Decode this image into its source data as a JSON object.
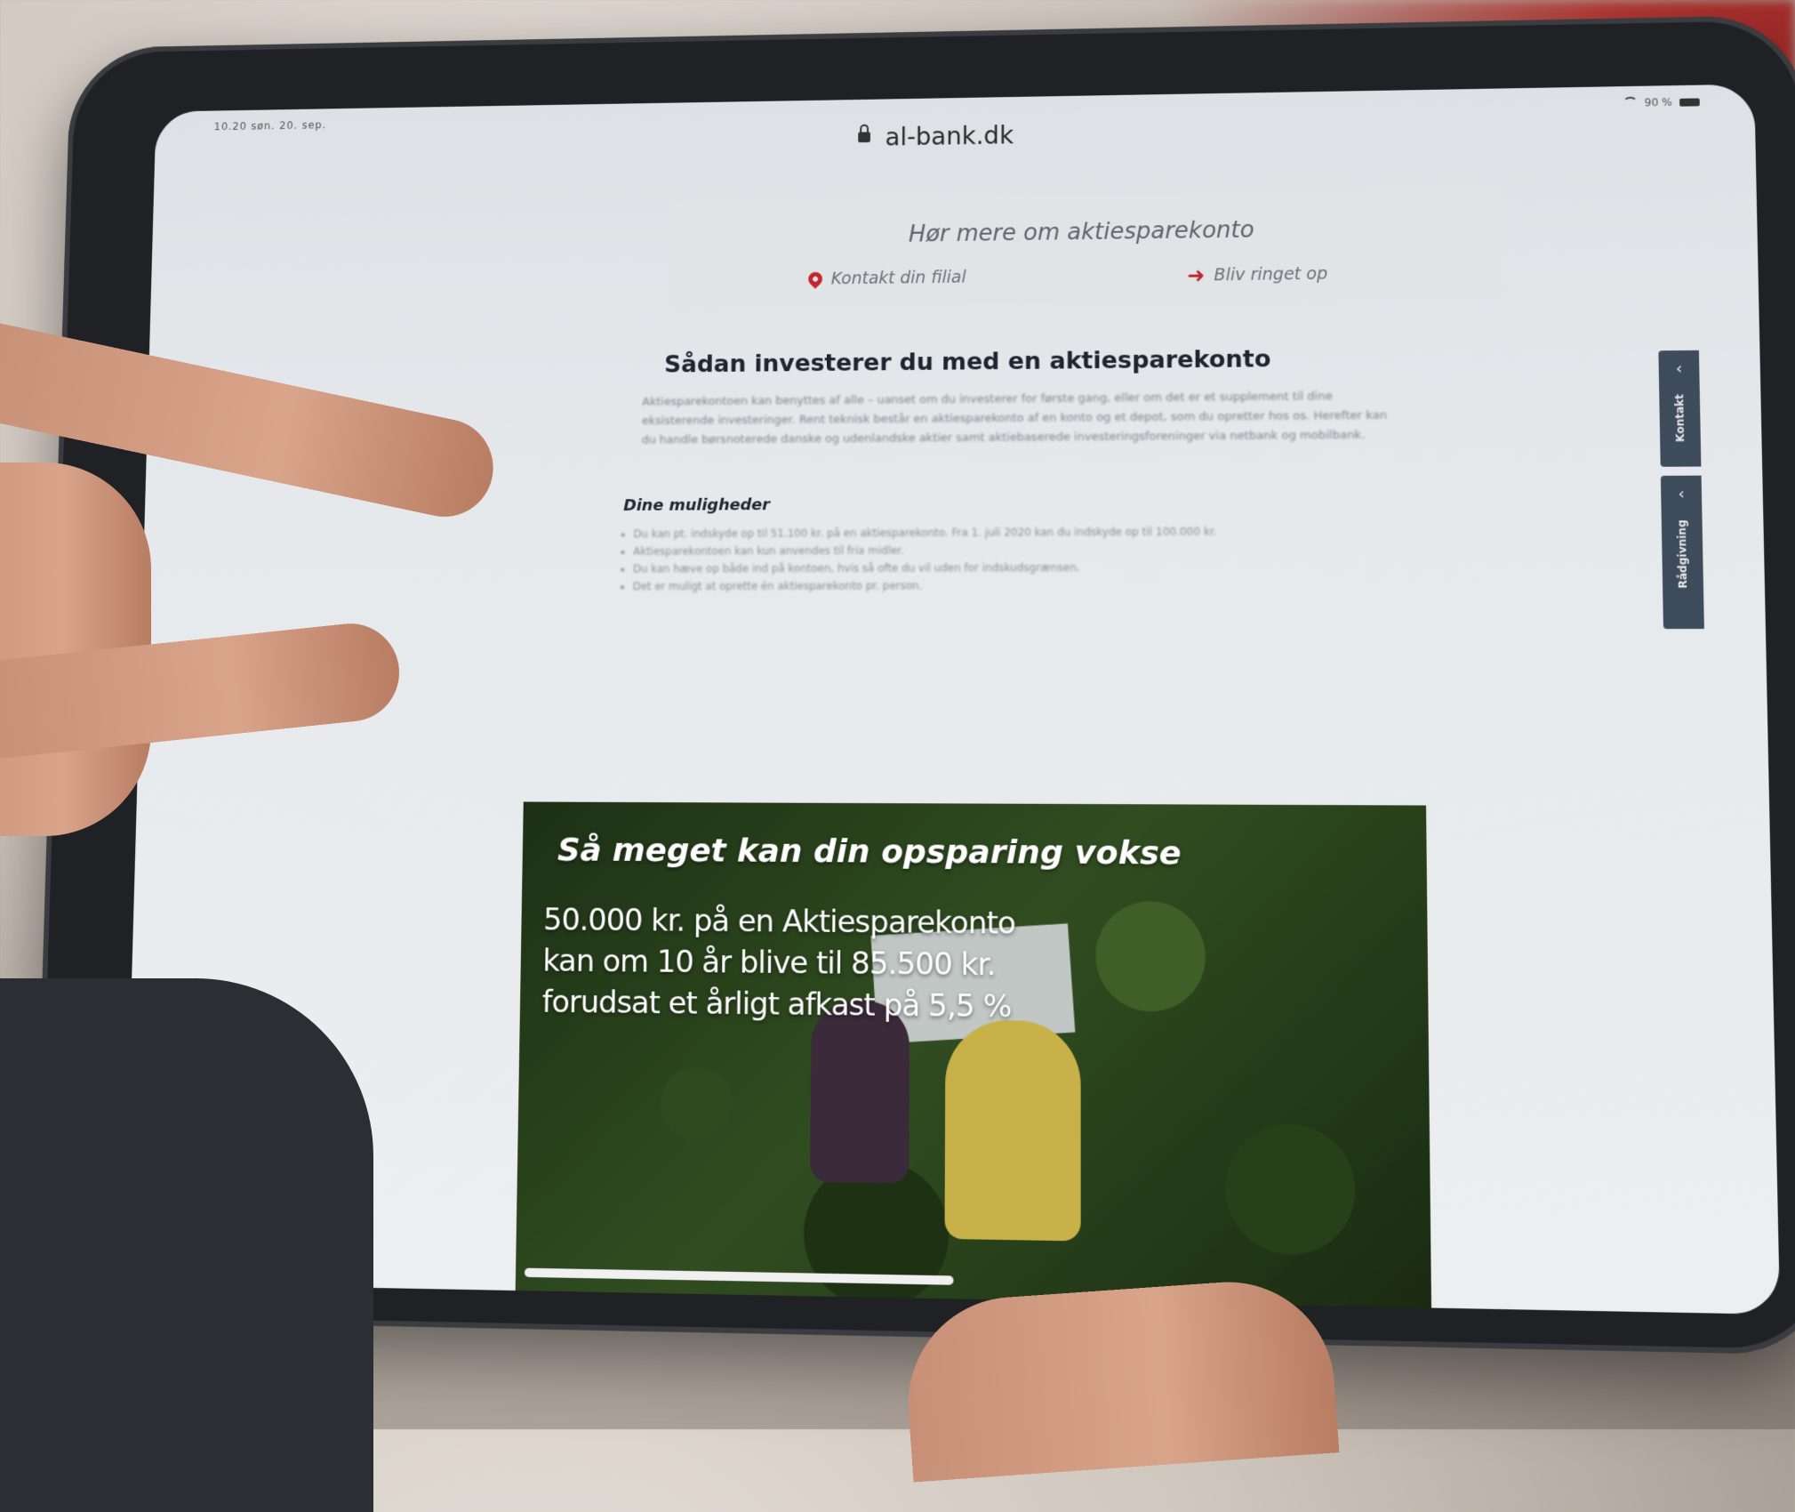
{
  "browser": {
    "url": "al-bank.dk",
    "status_time": "10.20 søn. 20. sep.",
    "status_battery": "90 %"
  },
  "contact": {
    "title": "Hør mere om aktiesparekonto",
    "branch_label": "Kontakt din filial",
    "call_label": "Bliv ringet op"
  },
  "article": {
    "title": "Sådan investerer du med en aktiesparekonto",
    "paragraph": "Aktiesparekontoen kan benyttes af alle – uanset om du investerer for første gang, eller om det er et supplement til dine eksisterende investeringer. Rent teknisk består en aktiesparekonto af en konto og et depot, som du opretter hos os. Herefter kan du handle børsnoterede danske og udenlandske aktier samt aktiebaserede investeringsforeninger via netbank og mobilbank.",
    "subheading": "Dine muligheder",
    "bullets": [
      "Du kan pt. indskyde op til 51.100 kr. på en aktiesparekonto. Fra 1. juli 2020 kan du indskyde op til 100.000 kr.",
      "Aktiesparekontoen kan kun anvendes til fria midler.",
      "Du kan hæve op både ind på kontoen, hvis så ofte du vil uden for indskudsgrænsen.",
      "Det er muligt at oprette én aktiesparekonto pr. person."
    ]
  },
  "side_tabs": {
    "tab1_label": "Kontakt",
    "tab2_label": "Rådgivning"
  },
  "banner": {
    "title": "Så meget kan din opsparing vokse",
    "text": "50.000 kr. på en Aktiesparekonto kan om 10 år blive til 85.500 kr. forudsat et årligt afkast på 5,5 %"
  },
  "colors": {
    "accent_red": "#c2262d",
    "side_tab_bg": "#3e4b5a"
  }
}
